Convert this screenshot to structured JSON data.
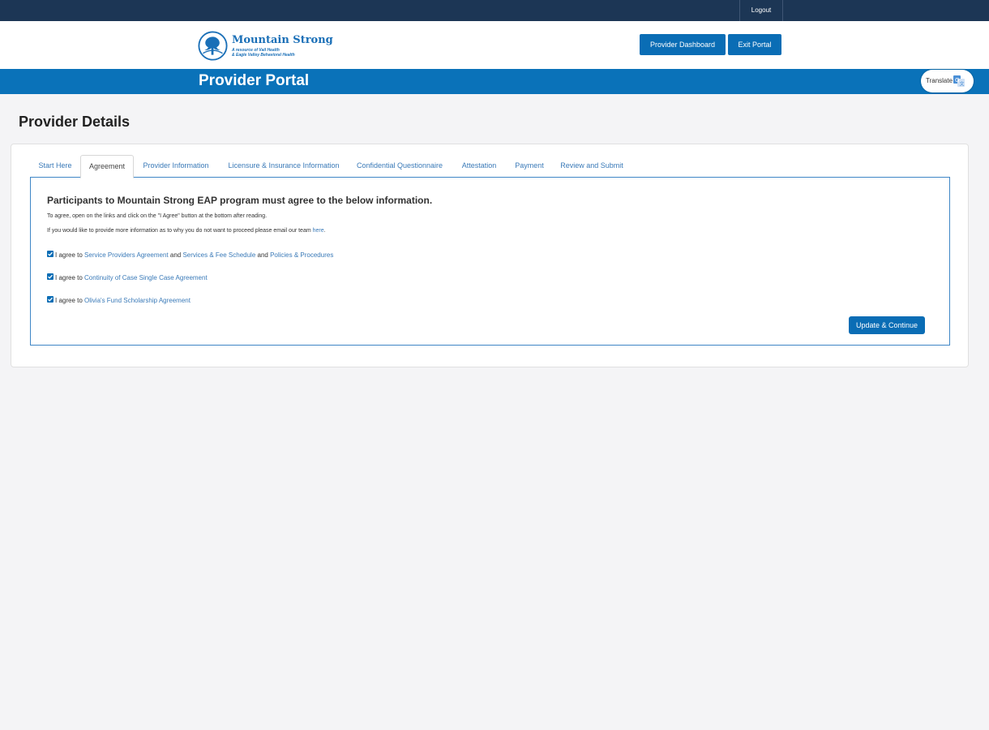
{
  "topbar": {
    "logout_label": "Logout"
  },
  "header": {
    "logo": {
      "title": "Mountain Strong",
      "sub1": "A resource of Vail Health",
      "sub2": "& Eagle Valley Behavioral Health"
    },
    "dashboard_label": "Provider Dashboard",
    "exit_label": "Exit Portal"
  },
  "banner": {
    "title": "Provider Portal",
    "translate_label": "Translate"
  },
  "page": {
    "title": "Provider Details"
  },
  "tabs": [
    {
      "label": "Start Here"
    },
    {
      "label": "Agreement"
    },
    {
      "label": "Provider Information"
    },
    {
      "label": "Licensure & Insurance Information"
    },
    {
      "label": "Confidential Questionnaire"
    },
    {
      "label": "Attestation"
    },
    {
      "label": "Payment"
    },
    {
      "label": "Review and Submit"
    }
  ],
  "panel": {
    "heading": "Participants to Mountain Strong EAP program must agree to the below information.",
    "instruction": "To agree, open on the links and click on the \"I Agree\" button at the bottom after reading.",
    "more_info_text": "If you would like to provide more information as to why you do not want to proceed please email our team ",
    "more_info_link": "here",
    "more_info_end": ".",
    "agreements": [
      {
        "prefix": "I agree to ",
        "link1": "Service Providers Agreement",
        "mid1": " and ",
        "link2": "Services & Fee Schedule",
        "mid2": " and ",
        "link3": "Policies & Procedures"
      },
      {
        "prefix": "I agree to ",
        "link1": "Continuity of Case Single Case Agreement"
      },
      {
        "prefix": "I agree to ",
        "link1": "Olivia's Fund Scholarship Agreement"
      }
    ],
    "update_label": "Update & Continue"
  },
  "colors": {
    "topbar": "#1c3655",
    "brand": "#0a72b9",
    "link": "#3a7ab8"
  }
}
